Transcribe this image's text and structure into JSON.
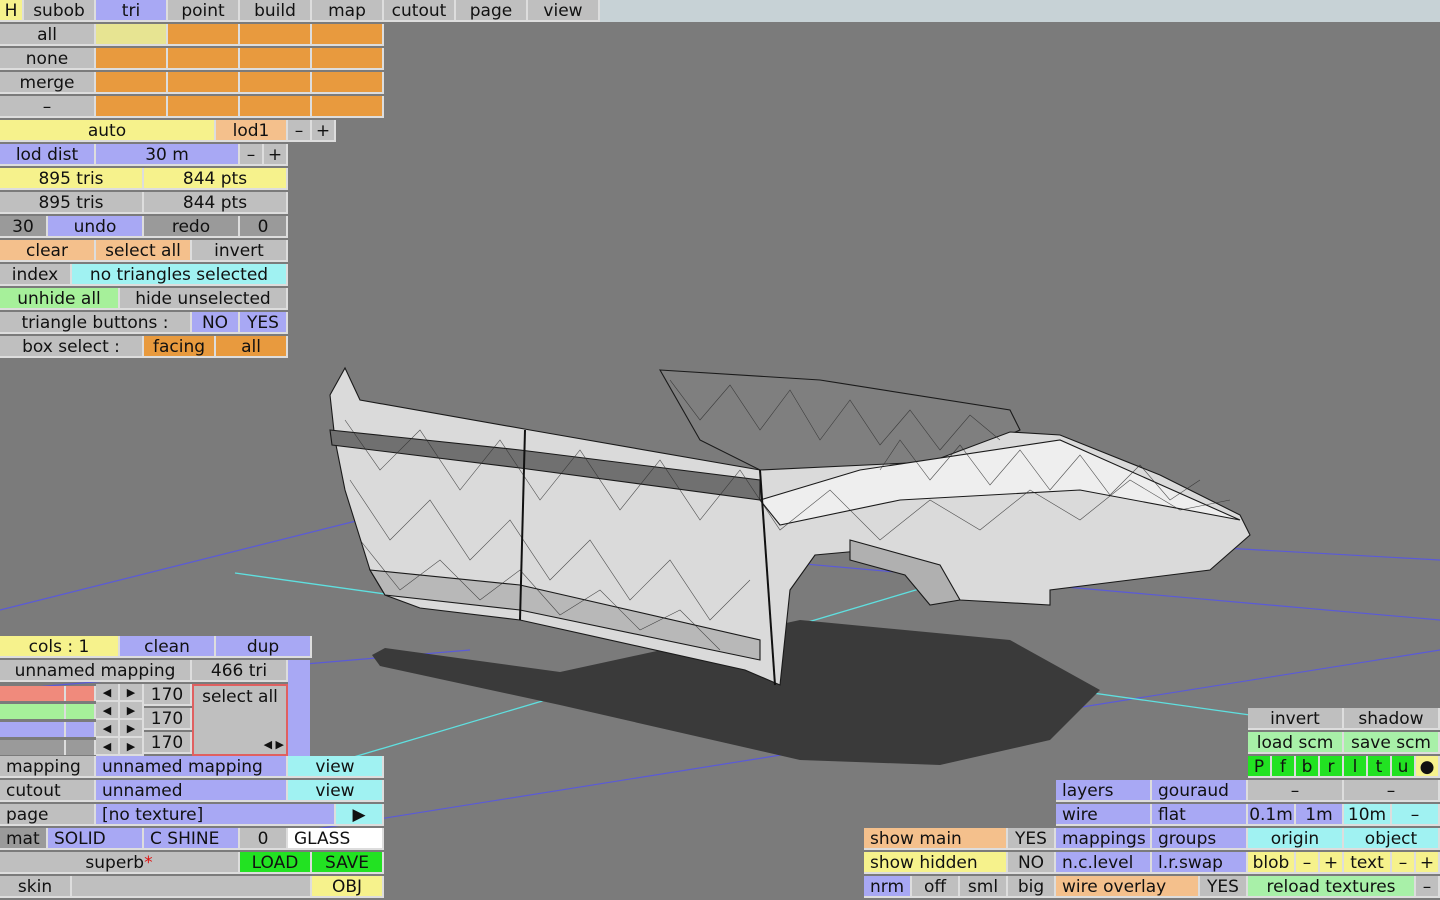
{
  "tabs": [
    "H",
    "subob",
    "tri",
    "point",
    "build",
    "map",
    "cutout",
    "page",
    "view"
  ],
  "select_panel": {
    "all": "all",
    "none": "none",
    "merge": "merge",
    "minus": "–"
  },
  "lod": {
    "auto": "auto",
    "name": "lod1",
    "minus": "–",
    "plus": "+",
    "dist_label": "lod dist",
    "dist_value": "30 m",
    "dist_minus": "–",
    "dist_plus": "+"
  },
  "counts": {
    "tris1": "895 tris",
    "pts1": "844 pts",
    "tris2": "895 tris",
    "pts2": "844 pts"
  },
  "history": {
    "steps": "30",
    "undo": "undo",
    "redo": "redo",
    "redo_count": "0"
  },
  "selection": {
    "clear": "clear",
    "select_all": "select all",
    "invert": "invert",
    "index": "index",
    "status": "no triangles selected",
    "unhide_all": "unhide all",
    "hide_unselected": "hide unselected",
    "tri_buttons_label": "triangle buttons :",
    "no": "NO",
    "yes": "YES",
    "box_select_label": "box select :",
    "facing": "facing",
    "all": "all"
  },
  "mapping_panel": {
    "cols": "cols : 1",
    "clean": "clean",
    "dup": "dup",
    "mapping_name": "unnamed mapping",
    "tri_count": "466 tri",
    "r": "170",
    "g": "170",
    "b": "170",
    "select_all": "select all"
  },
  "material": {
    "mapping_label": "mapping",
    "mapping_value": "unnamed mapping",
    "mapping_view": "view",
    "cutout_label": "cutout",
    "cutout_value": "unnamed",
    "cutout_view": "view",
    "page_label": "page",
    "page_value": "[no texture]",
    "page_arrow": "▶",
    "mat_label": "mat",
    "solid": "SOLID",
    "c_shine": "C SHINE",
    "shine_value": "0",
    "glass": "GLASS",
    "superb": "superb",
    "superb_star": "*",
    "load": "LOAD",
    "save": "SAVE",
    "skin": "skin",
    "obj": "OBJ"
  },
  "display": {
    "show_main": "show main",
    "show_main_val": "YES",
    "show_hidden": "show hidden",
    "show_hidden_val": "NO",
    "nrm": "nrm",
    "off": "off",
    "sml": "sml",
    "big": "big"
  },
  "render": {
    "layers": "layers",
    "gouraud": "gouraud",
    "wire": "wire",
    "flat": "flat",
    "mappings": "mappings",
    "groups": "groups",
    "nc_level": "n.c.level",
    "lr_swap": "l.r.swap",
    "wire_overlay": "wire overlay",
    "wire_overlay_val": "YES"
  },
  "right_panel": {
    "invert": "invert",
    "shadow": "shadow",
    "load_scm": "load scm",
    "save_scm": "save scm",
    "keys": [
      "P",
      "f",
      "b",
      "r",
      "l",
      "t",
      "u",
      "●"
    ],
    "dash1": "–",
    "dash2": "–",
    "grid_01": "0.1m",
    "grid_1": "1m",
    "grid_10": "10m",
    "grid_minus": "–",
    "origin": "origin",
    "object": "object",
    "blob": "blob",
    "blob_minus": "–",
    "blob_plus": "+",
    "text": "text",
    "text_minus": "–",
    "text_plus": "+",
    "reload": "reload textures",
    "reload_minus": "–"
  },
  "colors": {
    "viewport": "#7b7b7b",
    "blue": "#a8a8f4",
    "orange": "#e89a3e",
    "yellow": "#f6f28c",
    "cyan": "#a0f2f2",
    "green": "#22e222"
  }
}
